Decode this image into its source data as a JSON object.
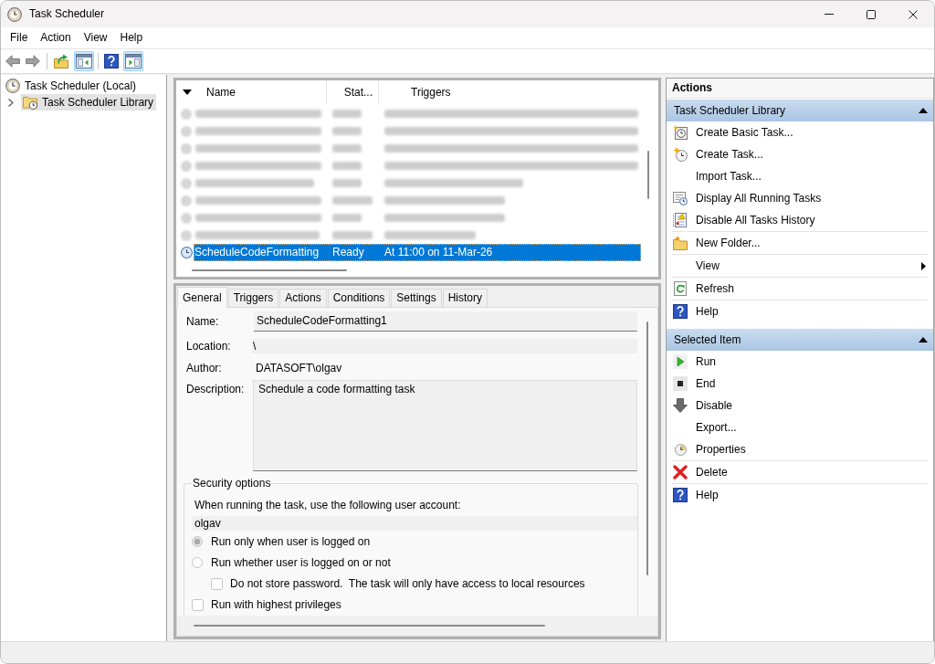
{
  "window": {
    "title": "Task Scheduler"
  },
  "menu": [
    {
      "label": "File"
    },
    {
      "label": "Action"
    },
    {
      "label": "View"
    },
    {
      "label": "Help"
    }
  ],
  "toolbar": [
    {
      "on": false
    },
    {
      "on": false
    },
    {
      "on": false
    },
    {
      "on": true
    },
    {
      "on": false
    },
    {
      "on": true
    }
  ],
  "tree": [
    {
      "label": "Task Scheduler (Local)",
      "selected": false,
      "children": [
        {
          "label": "Task Scheduler Library",
          "selected": true,
          "expanded": false
        }
      ]
    }
  ],
  "task_list": {
    "columns": [
      {
        "label": "Name",
        "sorted": true
      },
      {
        "label": "Stat...",
        "sorted": false
      },
      {
        "label": "Triggers",
        "sorted": false
      }
    ],
    "rows": [
      {
        "kind": "blurred",
        "selected": false
      },
      {
        "kind": "blurred",
        "selected": false
      },
      {
        "kind": "blurred",
        "selected": false
      },
      {
        "kind": "blurred",
        "selected": false
      },
      {
        "kind": "blurred",
        "selected": false
      },
      {
        "kind": "blurred",
        "selected": false
      },
      {
        "kind": "blurred",
        "selected": false
      },
      {
        "kind": "blurred",
        "selected": false
      },
      {
        "kind": "task",
        "name": "ScheduleCodeFormatting",
        "status": "Ready",
        "triggers": "At 11:00 on 11-Mar-26",
        "selected": true
      }
    ]
  },
  "details": {
    "tabs": [
      {
        "label": "General",
        "selected": true
      },
      {
        "label": "Triggers",
        "selected": false
      },
      {
        "label": "Actions",
        "selected": false
      },
      {
        "label": "Conditions",
        "selected": false
      },
      {
        "label": "Settings",
        "selected": false
      },
      {
        "label": "History",
        "selected": false
      }
    ],
    "fields": [
      {
        "kind": "field",
        "label": "Name:",
        "value": "ScheduleCodeFormatting1"
      },
      {
        "kind": "readonly",
        "label": "Location:",
        "value": "\\"
      },
      {
        "kind": "plain",
        "label": "Author:",
        "value": "DATASOFT\\olgav"
      },
      {
        "kind": "textarea",
        "label": "Description:",
        "value": "Schedule a code formatting task"
      }
    ],
    "security": {
      "title": "Security options",
      "account_label": "When running the task, use the following user account:",
      "account": "olgav",
      "options": [
        {
          "kind": "radio",
          "label": "Run only when user is logged on",
          "checked": true
        },
        {
          "kind": "radio",
          "label": "Run whether user is logged on or not",
          "checked": false,
          "children": [
            {
              "kind": "checkbox",
              "label": "Do not store password.  The task will only have access to local resources",
              "checked": false
            }
          ]
        },
        {
          "kind": "checkbox",
          "label": "Run with highest privileges",
          "checked": false
        }
      ]
    }
  },
  "actions": {
    "title": "Actions",
    "sections": [
      {
        "title": "Task Scheduler Library",
        "expanded": true,
        "groups": [
          [
            {
              "label": "Create Basic Task...",
              "kind": "command"
            },
            {
              "label": "Create Task...",
              "kind": "command"
            },
            {
              "label": "Import Task...",
              "kind": "command"
            },
            {
              "label": "Display All Running Tasks",
              "kind": "command"
            },
            {
              "label": "Disable All Tasks History",
              "kind": "command"
            }
          ],
          [
            {
              "label": "New Folder...",
              "kind": "command"
            }
          ],
          [
            {
              "label": "View",
              "kind": "submenu"
            }
          ],
          [
            {
              "label": "Refresh",
              "kind": "command"
            }
          ],
          [
            {
              "label": "Help",
              "kind": "command"
            }
          ]
        ]
      },
      {
        "title": "Selected Item",
        "expanded": true,
        "groups": [
          [
            {
              "label": "Run",
              "kind": "command"
            },
            {
              "label": "End",
              "kind": "command"
            },
            {
              "label": "Disable",
              "kind": "command"
            },
            {
              "label": "Export...",
              "kind": "command"
            },
            {
              "label": "Properties",
              "kind": "command"
            }
          ],
          [
            {
              "label": "Delete",
              "kind": "command"
            }
          ],
          [
            {
              "label": "Help",
              "kind": "command"
            }
          ]
        ]
      }
    ]
  }
}
